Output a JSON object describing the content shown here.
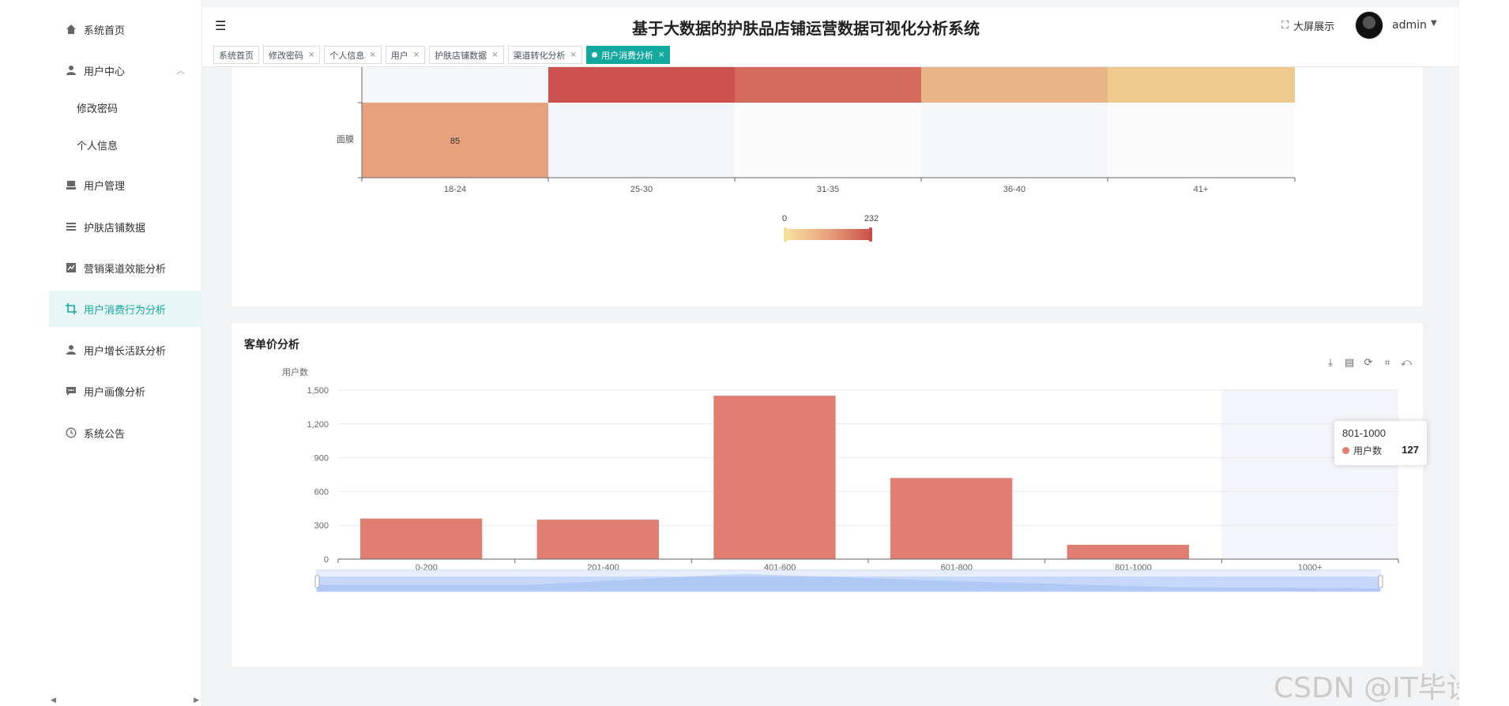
{
  "sidebar": {
    "items": [
      {
        "label": "系统首页",
        "icon": "home-icon"
      },
      {
        "label": "用户中心",
        "icon": "user-icon"
      },
      {
        "label": "修改密码"
      },
      {
        "label": "个人信息"
      },
      {
        "label": "用户管理",
        "icon": "user-manage-icon"
      },
      {
        "label": "护肤店铺数据",
        "icon": "list-icon"
      },
      {
        "label": "营销渠道效能分析",
        "icon": "chart-icon"
      },
      {
        "label": "用户消费行为分析",
        "icon": "crop-icon",
        "active": true
      },
      {
        "label": "用户增长活跃分析",
        "icon": "user-growth-icon"
      },
      {
        "label": "用户画像分析",
        "icon": "message-icon"
      },
      {
        "label": "系统公告",
        "icon": "clock-icon"
      }
    ]
  },
  "header": {
    "title": "基于大数据的护肤品店铺运营数据可视化分析系统",
    "screen_label": "大屏展示",
    "user": "admin"
  },
  "tabs": [
    {
      "label": "系统首页",
      "closable": false
    },
    {
      "label": "修改密码",
      "closable": true
    },
    {
      "label": "个人信息",
      "closable": true
    },
    {
      "label": "用户",
      "closable": true
    },
    {
      "label": "护肤店铺数据",
      "closable": true
    },
    {
      "label": "渠道转化分析",
      "closable": true
    },
    {
      "label": "用户消费分析",
      "closable": true,
      "active": true
    }
  ],
  "heatmap": {
    "x_categories": [
      "18-24",
      "25-30",
      "31-35",
      "36-40",
      "41+"
    ],
    "y_categories": [
      "面膜"
    ],
    "cell_label": "85",
    "visual_map": {
      "min": "0",
      "max": "232"
    },
    "colors": {
      "low": "#f6e3a0",
      "high": "#c9504a"
    }
  },
  "bar_card": {
    "title": "客单价分析",
    "toolbox": [
      "download-icon",
      "data-view-icon",
      "restore-icon",
      "zoom-icon",
      "zoom-reset-icon"
    ]
  },
  "chart_data": {
    "type": "bar",
    "categories": [
      "0-200",
      "201-400",
      "401-600",
      "601-800",
      "801-1000",
      "1000+"
    ],
    "series": [
      {
        "name": "用户数",
        "values": [
          360,
          350,
          1450,
          720,
          127,
          0
        ],
        "color": "#e07e72"
      }
    ],
    "ylabel": "用户数",
    "ylim": [
      0,
      1500
    ],
    "yticks": [
      "0",
      "300",
      "600",
      "900",
      "1,200",
      "1,500"
    ],
    "grid": true,
    "tooltip": {
      "title": "801-1000",
      "name": "用户数",
      "value": "127"
    }
  },
  "watermark": "CSDN @IT毕设梦工厂"
}
